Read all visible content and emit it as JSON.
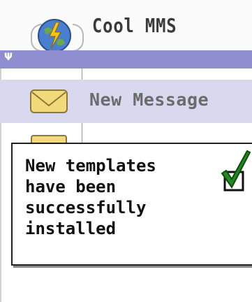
{
  "app": {
    "title": "Cool MMS",
    "app_icon": "globe-lightning-icon",
    "signal_icon": "antenna-icon"
  },
  "menu": {
    "items": [
      {
        "label": "New Message",
        "icon": "envelope-icon",
        "selected": true
      },
      {
        "label": "",
        "icon": "folder-icon",
        "selected": false
      }
    ]
  },
  "notification": {
    "lines": [
      "New templates",
      "have been",
      "successfully",
      "installed"
    ],
    "icon": "checkmark-box-icon"
  },
  "colors": {
    "signal_bar": "#8e8ed0",
    "selection": "#d8d8ee",
    "check_green": "#1f8a1f"
  }
}
